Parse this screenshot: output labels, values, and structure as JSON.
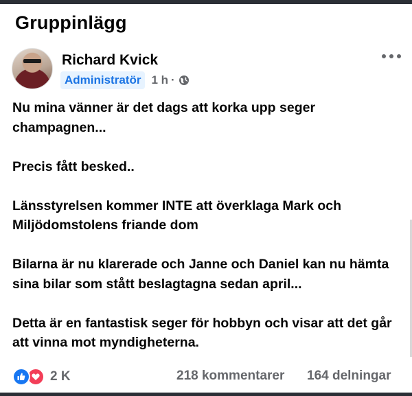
{
  "section": {
    "title": "Gruppinlägg"
  },
  "post": {
    "author": {
      "name": "Richard Kvick",
      "role": "Administratör"
    },
    "time": "1 h",
    "separator": "·",
    "paragraphs": [
      "Nu mina vänner är det dags att korka upp seger champagnen...",
      "Precis fått besked..",
      "Länsstyrelsen kommer INTE att överklaga Mark och Miljödomstolens friande dom",
      "Bilarna är nu klarerade och Janne och Daniel kan nu hämta sina bilar som stått beslagtagna sedan april...",
      "Detta är en fantastisk seger för hobbyn och visar att det går att vinna mot myndigheterna."
    ],
    "reactions": {
      "count": "2 K",
      "icons": [
        "like-icon",
        "love-icon"
      ]
    },
    "comments": "218 kommentarer",
    "shares": "164 delningar"
  },
  "colors": {
    "accent": "#1b74e4",
    "badge_bg": "#e7f3ff",
    "secondary_text": "#65676b",
    "like": "#1877f2",
    "love": "#f33e58"
  }
}
